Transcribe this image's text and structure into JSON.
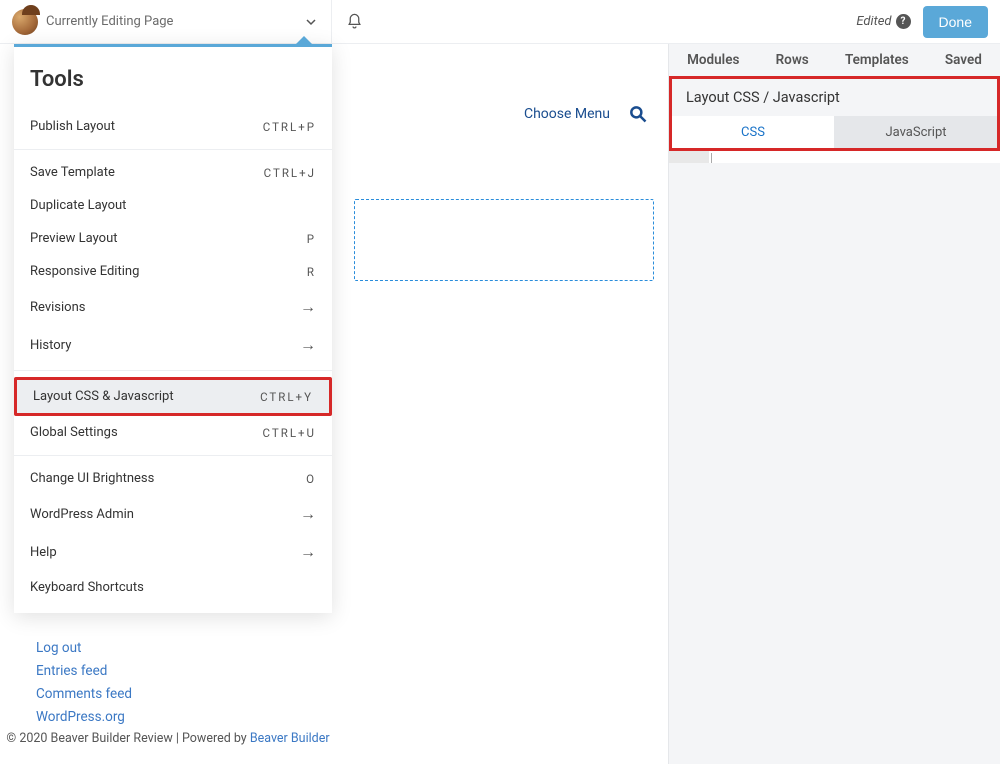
{
  "topbar": {
    "title": "Currently Editing Page",
    "edited_label": "Edited",
    "done_label": "Done"
  },
  "tools": {
    "heading": "Tools",
    "items": {
      "publish": {
        "label": "Publish Layout",
        "shortcut": "CTRL+P"
      },
      "save_template": {
        "label": "Save Template",
        "shortcut": "CTRL+J"
      },
      "duplicate": {
        "label": "Duplicate Layout"
      },
      "preview": {
        "label": "Preview Layout",
        "shortcut": "P"
      },
      "responsive": {
        "label": "Responsive Editing",
        "shortcut": "R"
      },
      "revisions": {
        "label": "Revisions"
      },
      "history": {
        "label": "History"
      },
      "css_js": {
        "label": "Layout CSS & Javascript",
        "shortcut": "CTRL+Y"
      },
      "global": {
        "label": "Global Settings",
        "shortcut": "CTRL+U"
      },
      "brightness": {
        "label": "Change UI Brightness",
        "shortcut": "O"
      },
      "wpadmin": {
        "label": "WordPress Admin"
      },
      "help": {
        "label": "Help"
      },
      "keyboard": {
        "label": "Keyboard Shortcuts"
      }
    }
  },
  "canvas": {
    "choose_menu": "Choose Menu"
  },
  "sidebar_links": {
    "logout": "Log out",
    "entries": "Entries feed",
    "comments": "Comments feed",
    "wporg": "WordPress.org"
  },
  "footer": {
    "text": "© 2020 Beaver Builder Review | Powered by ",
    "link": "Beaver Builder"
  },
  "right_panel": {
    "tabs": {
      "modules": "Modules",
      "rows": "Rows",
      "templates": "Templates",
      "saved": "Saved"
    },
    "header": "Layout CSS / Javascript",
    "subtabs": {
      "css": "CSS",
      "js": "JavaScript"
    }
  }
}
